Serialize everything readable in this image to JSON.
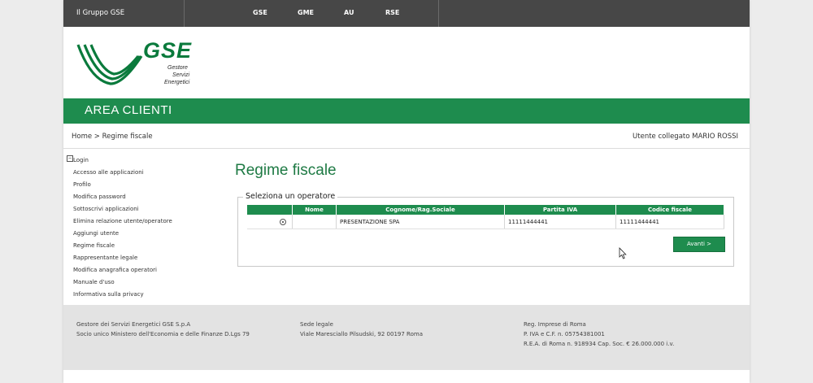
{
  "topbar": {
    "group_label": "Il Gruppo GSE",
    "nav": [
      "GSE",
      "GME",
      "AU",
      "RSE"
    ]
  },
  "logo": {
    "text": "GSE",
    "line1": "Gestore",
    "line2": "Servizi",
    "line3": "Energetici",
    "color": "#0a7a3c"
  },
  "banner": {
    "title": "AREA CLIENTI",
    "color": "#1e8c4e"
  },
  "breadcrumb": {
    "text": "Home > Regime fiscale"
  },
  "user": {
    "text": "Utente collegato MARIO ROSSI"
  },
  "sidebar": {
    "toggle": "−",
    "items": [
      "Login",
      "Accesso alle applicazioni",
      "Profilo",
      "Modifica password",
      "Sottoscrivi applicazioni",
      "Elimina relazione utente/operatore",
      "Aggiungi utente",
      "Regime fiscale",
      "Rappresentante legale",
      "Modifica anagrafica operatori",
      "Manuale d'uso",
      "Informativa sulla privacy"
    ]
  },
  "main": {
    "title": "Regime fiscale",
    "fieldset_legend": "Seleziona un operatore",
    "table": {
      "headers": [
        "",
        "Nome",
        "Cognome/Rag.Sociale",
        "Partita IVA",
        "Codice fiscale"
      ],
      "rows": [
        {
          "selected": true,
          "nome": "",
          "ragione": "PRESENTAZIONE SPA",
          "piva": "11111444441",
          "cf": "11111444441"
        }
      ]
    },
    "next_button": "Avanti >"
  },
  "footer": {
    "col1": [
      "Gestore dei Servizi Energetici GSE S.p.A",
      "Socio unico Ministero dell'Economia e delle Finanze D.Lgs 79"
    ],
    "col2": [
      "Sede legale",
      "Viale Maresciallo Pilsudski, 92 00197 Roma"
    ],
    "col3": [
      "Reg. Imprese di Roma",
      "P. IVA e C.F. n. 05754381001",
      "R.E.A. di Roma n. 918934 Cap. Soc. € 26.000.000 i.v."
    ]
  }
}
